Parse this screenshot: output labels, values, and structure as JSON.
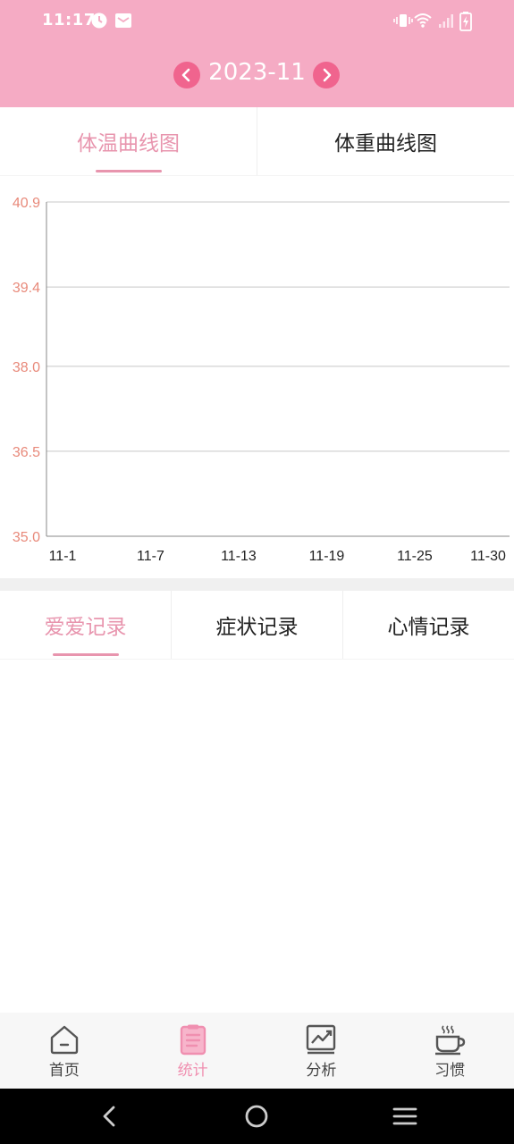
{
  "status_bar": {
    "time": "11:17",
    "icons": [
      "clock-icon",
      "mail-icon",
      "vibrate-icon",
      "wifi-icon",
      "signal-icon",
      "battery-icon"
    ]
  },
  "header": {
    "month": "2023-11",
    "prev_icon": "chevron-left-icon",
    "next_icon": "chevron-right-icon",
    "background_color": "#f5abc4",
    "button_color": "#f0648e"
  },
  "chart_tabs": [
    {
      "label": "体温曲线图",
      "active": true
    },
    {
      "label": "体重曲线图",
      "active": false
    }
  ],
  "chart_data": {
    "type": "line",
    "title": "",
    "xlabel": "",
    "ylabel": "",
    "x_ticks": [
      "11-1",
      "11-7",
      "11-13",
      "11-19",
      "11-25",
      "11-30"
    ],
    "y_ticks": [
      "40.9",
      "39.4",
      "38.0",
      "36.5",
      "35.0"
    ],
    "ylim": [
      35.0,
      40.9
    ],
    "series": [],
    "grid": true,
    "y_tick_color": "#e8897a"
  },
  "record_tabs": [
    {
      "label": "爱爱记录",
      "active": true
    },
    {
      "label": "症状记录",
      "active": false
    },
    {
      "label": "心情记录",
      "active": false
    }
  ],
  "accent_color": "#e895ae",
  "bottom_nav": [
    {
      "label": "首页",
      "icon": "home-icon",
      "active": false
    },
    {
      "label": "统计",
      "icon": "clipboard-icon",
      "active": true
    },
    {
      "label": "分析",
      "icon": "analysis-chart-icon",
      "active": false
    },
    {
      "label": "习惯",
      "icon": "coffee-cup-icon",
      "active": false
    }
  ],
  "system_nav": [
    "back-icon",
    "home-circle-icon",
    "menu-icon"
  ]
}
